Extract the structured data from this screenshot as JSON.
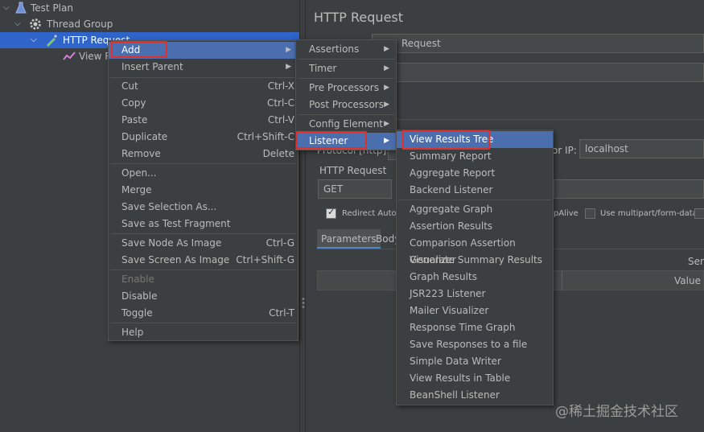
{
  "tree": {
    "items": [
      {
        "label": "Test Plan"
      },
      {
        "label": "Thread Group"
      },
      {
        "label": "HTTP Request"
      },
      {
        "label": "View R"
      }
    ]
  },
  "right_panel": {
    "title": "HTTP Request",
    "name_value": "Request",
    "server_label": "or IP:",
    "server_value": "localhost",
    "protocol_label": "Protocol [http]:",
    "http_request_label": "HTTP Request",
    "method_value": "GET",
    "redirect_label": "Redirect Autom",
    "keepalive_label": "pAlive",
    "multipart_label": "Use multipart/form-data",
    "tab_parameters": "Parameters",
    "tab_body": "Body",
    "send_label": "Sen",
    "value_header": "Value"
  },
  "context_menu": {
    "items": [
      {
        "label": "Add",
        "shortcut": ""
      },
      {
        "label": "Insert Parent",
        "shortcut": ""
      },
      {
        "label": "Cut",
        "shortcut": "Ctrl-X"
      },
      {
        "label": "Copy",
        "shortcut": "Ctrl-C"
      },
      {
        "label": "Paste",
        "shortcut": "Ctrl-V"
      },
      {
        "label": "Duplicate",
        "shortcut": "Ctrl+Shift-C"
      },
      {
        "label": "Remove",
        "shortcut": "Delete"
      },
      {
        "label": "Open...",
        "shortcut": ""
      },
      {
        "label": "Merge",
        "shortcut": ""
      },
      {
        "label": "Save Selection As...",
        "shortcut": ""
      },
      {
        "label": "Save as Test Fragment",
        "shortcut": ""
      },
      {
        "label": "Save Node As Image",
        "shortcut": "Ctrl-G"
      },
      {
        "label": "Save Screen As Image",
        "shortcut": "Ctrl+Shift-G"
      },
      {
        "label": "Enable",
        "shortcut": ""
      },
      {
        "label": "Disable",
        "shortcut": ""
      },
      {
        "label": "Toggle",
        "shortcut": "Ctrl-T"
      },
      {
        "label": "Help",
        "shortcut": ""
      }
    ]
  },
  "add_submenu": {
    "items": [
      {
        "label": "Assertions"
      },
      {
        "label": "Timer"
      },
      {
        "label": "Pre Processors"
      },
      {
        "label": "Post Processors"
      },
      {
        "label": "Config Element"
      },
      {
        "label": "Listener"
      }
    ]
  },
  "listener_submenu": {
    "items": [
      {
        "label": "View Results Tree"
      },
      {
        "label": "Summary Report"
      },
      {
        "label": "Aggregate Report"
      },
      {
        "label": "Backend Listener"
      },
      {
        "label": "Aggregate Graph"
      },
      {
        "label": "Assertion Results"
      },
      {
        "label": "Comparison Assertion Visualizer"
      },
      {
        "label": "Generate Summary Results"
      },
      {
        "label": "Graph Results"
      },
      {
        "label": "JSR223 Listener"
      },
      {
        "label": "Mailer Visualizer"
      },
      {
        "label": "Response Time Graph"
      },
      {
        "label": "Save Responses to a file"
      },
      {
        "label": "Simple Data Writer"
      },
      {
        "label": "View Results in Table"
      },
      {
        "label": "BeanShell Listener"
      }
    ]
  },
  "watermark": "@稀土掘金技术社区",
  "colors": {
    "highlight": "#4b6eaf",
    "selection": "#2f65ca",
    "annotation": "#e0302a",
    "background": "#3c3f41"
  }
}
